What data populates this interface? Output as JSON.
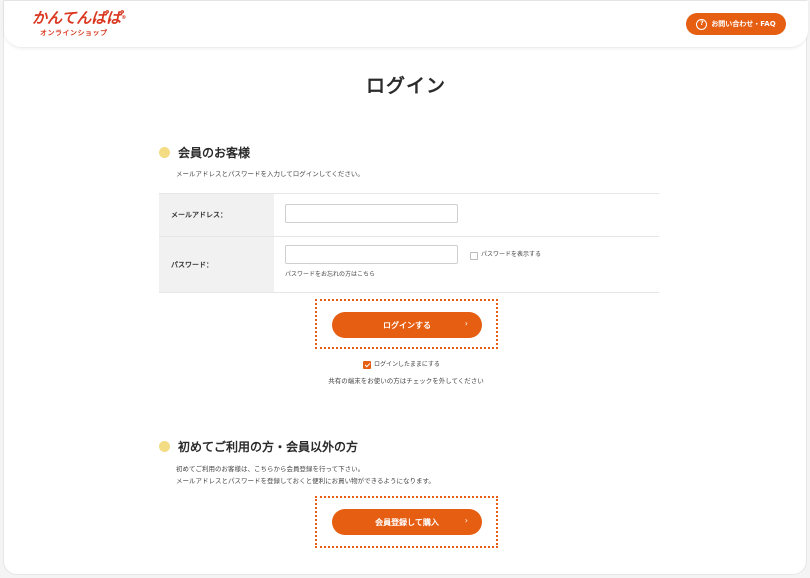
{
  "header": {
    "logo_main": "かんてんぱぱ",
    "logo_reg": "®",
    "logo_sub": "オンラインショップ",
    "faq_icon": "?",
    "faq_label": "お問い合わせ・FAQ"
  },
  "page": {
    "title": "ログイン"
  },
  "member": {
    "heading": "会員のお客様",
    "description": "メールアドレスとパスワードを入力してログインしてください。",
    "email_label": "メールアドレス：",
    "email_value": "",
    "password_label": "パスワード：",
    "password_value": "",
    "show_password_label": "パスワードを表示する",
    "forgot_link": "パスワードをお忘れの方はこちら",
    "login_button": "ログインする",
    "login_chevron": "›",
    "remember_label": "ログインしたままにする",
    "remember_note": "共有の端末をお使いの方はチェックを外してください"
  },
  "guest": {
    "heading": "初めてご利用の方・会員以外の方",
    "line1": "初めてご利用のお客様は、こちらから会員登録を行って下さい。",
    "line2": "メールアドレスとパスワードを登録しておくと便利にお買い物ができるようになります。",
    "register_button": "会員登録して購入",
    "register_chevron": "›"
  },
  "colors": {
    "accent": "#e65e12",
    "logo": "#d9371f",
    "bullet": "#f3dc84"
  }
}
